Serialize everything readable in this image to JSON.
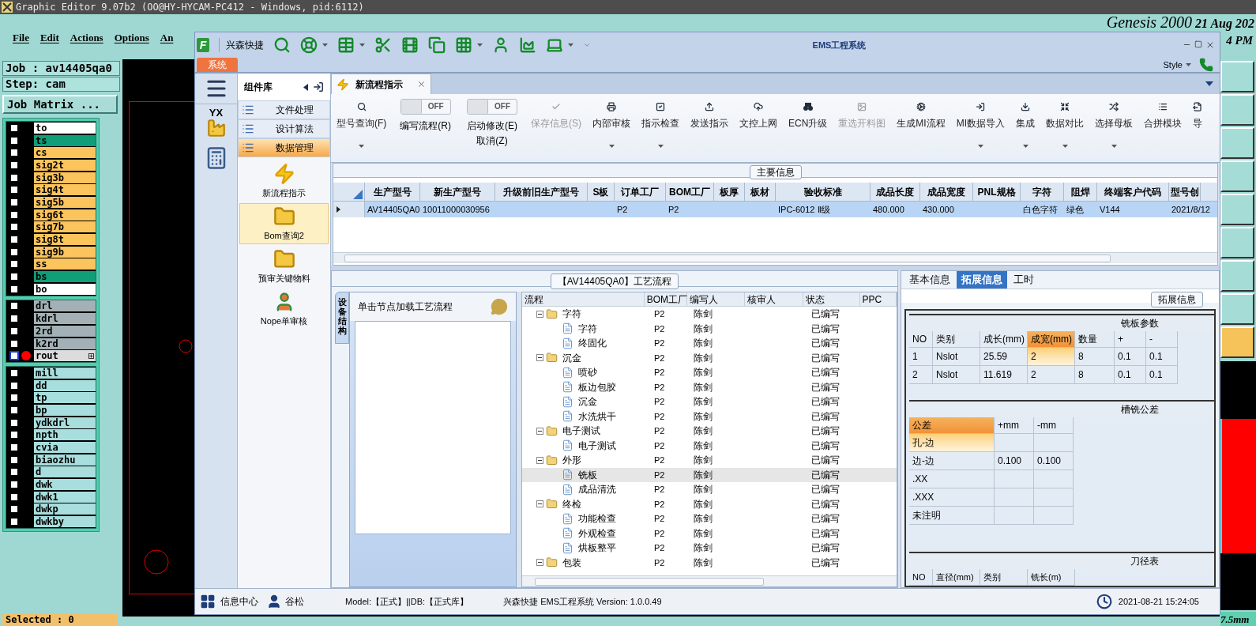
{
  "editor": {
    "title": "Graphic Editor 9.07b2 (OO@HY-HYCAM-PC412 - Windows, pid:6112)",
    "menu": [
      "File",
      "Edit",
      "Actions",
      "Options",
      "An"
    ],
    "brand": "Genesis 2000",
    "date": "21 Aug 202",
    "time": "4 PM",
    "job": "Job : av14405qa0",
    "step": "Step: cam",
    "job_matrix": "Job Matrix ...",
    "layer_groups": [
      {
        "layers": [
          {
            "name": "to",
            "color": "#ffffff",
            "checked": false,
            "selected": false
          },
          {
            "name": "ts",
            "color": "#0f9e78",
            "checked": false,
            "selected": false
          },
          {
            "name": "cs",
            "color": "#fcc45c",
            "checked": false,
            "selected": false
          },
          {
            "name": "sig2t",
            "color": "#fcc45c",
            "checked": false,
            "selected": false
          },
          {
            "name": "sig3b",
            "color": "#fcc45c",
            "checked": false,
            "selected": false
          },
          {
            "name": "sig4t",
            "color": "#fcc45c",
            "checked": false,
            "selected": false
          },
          {
            "name": "sig5b",
            "color": "#fcc45c",
            "checked": false,
            "selected": false
          },
          {
            "name": "sig6t",
            "color": "#fcc45c",
            "checked": false,
            "selected": false
          },
          {
            "name": "sig7b",
            "color": "#fcc45c",
            "checked": false,
            "selected": false
          },
          {
            "name": "sig8t",
            "color": "#fcc45c",
            "checked": false,
            "selected": false
          },
          {
            "name": "sig9b",
            "color": "#fcc45c",
            "checked": false,
            "selected": false
          },
          {
            "name": "ss",
            "color": "#fcc45c",
            "checked": false,
            "selected": false
          },
          {
            "name": "bs",
            "color": "#0f9e78",
            "checked": false,
            "selected": false
          },
          {
            "name": "bo",
            "color": "#ffffff",
            "checked": false,
            "selected": false
          }
        ]
      },
      {
        "layers": [
          {
            "name": "drl",
            "color": "#a3b1b6",
            "checked": false,
            "selected": false
          },
          {
            "name": "kdrl",
            "color": "#a3b1b6",
            "checked": false,
            "selected": false
          },
          {
            "name": "2rd",
            "color": "#a3b1b6",
            "checked": false,
            "selected": false
          },
          {
            "name": "k2rd",
            "color": "#a3b1b6",
            "checked": false,
            "selected": false
          },
          {
            "name": "rout",
            "color": "#dcdcdc",
            "checked": false,
            "selected": true
          }
        ]
      },
      {
        "layers": [
          {
            "name": "mill",
            "color": "#a8dedd",
            "checked": false,
            "selected": false
          },
          {
            "name": "dd",
            "color": "#a8dedd",
            "checked": false,
            "selected": false
          },
          {
            "name": "tp",
            "color": "#a8dedd",
            "checked": false,
            "selected": false
          },
          {
            "name": "bp",
            "color": "#a8dedd",
            "checked": false,
            "selected": false
          },
          {
            "name": "ydkdrl",
            "color": "#a8dedd",
            "checked": false,
            "selected": false
          },
          {
            "name": "npth",
            "color": "#a8dedd",
            "checked": false,
            "selected": false
          },
          {
            "name": "cvia",
            "color": "#a8dedd",
            "checked": false,
            "selected": false
          },
          {
            "name": "biaozhu",
            "color": "#a8dedd",
            "checked": false,
            "selected": false
          },
          {
            "name": "d",
            "color": "#a8dedd",
            "checked": false,
            "selected": false
          },
          {
            "name": "dwk",
            "color": "#a8dedd",
            "checked": false,
            "selected": false
          },
          {
            "name": "dwk1",
            "color": "#a8dedd",
            "checked": false,
            "selected": false
          },
          {
            "name": "dwkp",
            "color": "#a8dedd",
            "checked": false,
            "selected": false
          },
          {
            "name": "dwkby",
            "color": "#a8dedd",
            "checked": false,
            "selected": false
          }
        ]
      }
    ],
    "selected_count": "Selected : 0",
    "scale": "7.5mm"
  },
  "ems": {
    "logo_text": "F",
    "quick_label": "兴森快捷",
    "title": "EMS工程系统",
    "menu_tab": "系统",
    "style_label": "Style",
    "nav_logo_text": "YX",
    "library": {
      "title": "组件库",
      "groups": [
        {
          "label": "文件处理",
          "selected": false
        },
        {
          "label": "设计算法",
          "selected": false
        },
        {
          "label": "数据管理",
          "selected": true
        }
      ],
      "items": [
        {
          "label": "新流程指示",
          "kind": "lightning",
          "selected": false
        },
        {
          "label": "Bom查询2",
          "kind": "folder",
          "selected": true
        },
        {
          "label": "预审关键物料",
          "kind": "folder",
          "selected": false
        },
        {
          "label": "Nope单审核",
          "kind": "person",
          "selected": false
        }
      ]
    },
    "doc_tab": {
      "label": "新流程指示"
    },
    "toolbar": [
      {
        "kind": "button",
        "label": "型号查询(F)",
        "dropdown": true,
        "disabled": false
      },
      {
        "kind": "toggle",
        "label": "编写流程(R)",
        "state_text": "OFF",
        "on": false
      },
      {
        "kind": "toggle",
        "label": "启动修改(E)",
        "sublabel": "取消(Z)",
        "state_text": "OFF",
        "on": false
      },
      {
        "kind": "button",
        "label": "保存信息(S)",
        "dropdown": false,
        "disabled": true
      },
      {
        "kind": "button",
        "label": "内部审核",
        "dropdown": true,
        "disabled": false
      },
      {
        "kind": "button",
        "label": "指示检查",
        "dropdown": true,
        "disabled": false
      },
      {
        "kind": "button",
        "label": "发送指示",
        "dropdown": false,
        "disabled": false
      },
      {
        "kind": "button",
        "label": "文控上网",
        "dropdown": false,
        "disabled": false
      },
      {
        "kind": "button",
        "label": "ECN升级",
        "dropdown": false,
        "disabled": false
      },
      {
        "kind": "button",
        "label": "重选开料图",
        "dropdown": false,
        "disabled": true
      },
      {
        "kind": "button",
        "label": "生成MI流程",
        "dropdown": false,
        "disabled": false
      },
      {
        "kind": "button",
        "label": "MI数据导入",
        "dropdown": true,
        "disabled": false
      },
      {
        "kind": "button",
        "label": "集成",
        "dropdown": true,
        "disabled": false
      },
      {
        "kind": "button",
        "label": "数据对比",
        "dropdown": true,
        "disabled": false
      },
      {
        "kind": "button",
        "label": "选择母板",
        "dropdown": true,
        "disabled": false
      },
      {
        "kind": "button",
        "label": "合拼模块",
        "dropdown": false,
        "disabled": false
      },
      {
        "kind": "button",
        "label": "导",
        "dropdown": false,
        "disabled": false
      }
    ],
    "main_info": {
      "title": "主要信息",
      "columns": [
        "生产型号",
        "新生产型号",
        "升级前旧生产型号",
        "S板",
        "订单工厂",
        "BOM工厂",
        "板厚",
        "板材",
        "验收标准",
        "成品长度",
        "成品宽度",
        "PNL规格",
        "字符",
        "阻焊",
        "终端客户代码",
        "型号创"
      ],
      "rows": [
        {
          "selected": true,
          "cells": [
            "AV14405QA0",
            "10011000030956",
            null,
            null,
            "P2",
            "P2",
            null,
            null,
            "IPC-6012 Ⅱ级",
            "480.000",
            "430.000",
            null,
            "白色字符",
            "绿色",
            "V144",
            "2021/8/12"
          ]
        }
      ]
    },
    "process": {
      "title": "【AV14405QA0】工艺流程",
      "side_tab": "设备结构",
      "hint": "单击节点加载工艺流程",
      "columns": [
        "流程",
        "BOM工厂",
        "编写人",
        "核审人",
        "状态",
        "PPC"
      ],
      "tree": [
        {
          "name": "字符",
          "bom": "P2",
          "author": "陈剑",
          "status": "已编写",
          "expanded": true,
          "selected": false,
          "children": [
            {
              "name": "字符",
              "bom": "P2",
              "author": "陈剑",
              "status": "已编写",
              "selected": false
            },
            {
              "name": "终固化",
              "bom": "P2",
              "author": "陈剑",
              "status": "已编写",
              "selected": false
            }
          ]
        },
        {
          "name": "沉金",
          "bom": "P2",
          "author": "陈剑",
          "status": "已编写",
          "expanded": true,
          "selected": false,
          "children": [
            {
              "name": "喷砂",
              "bom": "P2",
              "author": "陈剑",
              "status": "已编写",
              "selected": false
            },
            {
              "name": "板边包胶",
              "bom": "P2",
              "author": "陈剑",
              "status": "已编写",
              "selected": false
            },
            {
              "name": "沉金",
              "bom": "P2",
              "author": "陈剑",
              "status": "已编写",
              "selected": false
            },
            {
              "name": "水洗烘干",
              "bom": "P2",
              "author": "陈剑",
              "status": "已编写",
              "selected": false
            }
          ]
        },
        {
          "name": "电子测试",
          "bom": "P2",
          "author": "陈剑",
          "status": "已编写",
          "expanded": true,
          "selected": false,
          "children": [
            {
              "name": "电子测试",
              "bom": "P2",
              "author": "陈剑",
              "status": "已编写",
              "selected": false
            }
          ]
        },
        {
          "name": "外形",
          "bom": "P2",
          "author": "陈剑",
          "status": "已编写",
          "expanded": true,
          "selected": false,
          "children": [
            {
              "name": "铣板",
              "bom": "P2",
              "author": "陈剑",
              "status": "已编写",
              "selected": true
            },
            {
              "name": "成品清洗",
              "bom": "P2",
              "author": "陈剑",
              "status": "已编写",
              "selected": false
            }
          ]
        },
        {
          "name": "终检",
          "bom": "P2",
          "author": "陈剑",
          "status": "已编写",
          "expanded": true,
          "selected": false,
          "children": [
            {
              "name": "功能检查",
              "bom": "P2",
              "author": "陈剑",
              "status": "已编写",
              "selected": false
            },
            {
              "name": "外观检查",
              "bom": "P2",
              "author": "陈剑",
              "status": "已编写",
              "selected": false
            },
            {
              "name": "烘板整平",
              "bom": "P2",
              "author": "陈剑",
              "status": "已编写",
              "selected": false
            }
          ]
        },
        {
          "name": "包装",
          "bom": "P2",
          "author": "陈剑",
          "status": "已编写",
          "expanded": true,
          "selected": false
        }
      ]
    },
    "details": {
      "tabs": [
        {
          "label": "基本信息",
          "selected": false
        },
        {
          "label": "拓展信息",
          "selected": true
        },
        {
          "label": "工时",
          "selected": false
        }
      ],
      "group_title": "拓展信息",
      "mill_params": {
        "title": "铣板参数",
        "columns": [
          {
            "label": "NO",
            "selected": false
          },
          {
            "label": "类别",
            "selected": false
          },
          {
            "label": "成长(mm)",
            "selected": false
          },
          {
            "label": "成宽(mm)",
            "selected": true
          },
          {
            "label": "数量",
            "selected": false
          },
          {
            "label": "+",
            "selected": false
          },
          {
            "label": "-",
            "selected": false
          }
        ],
        "rows": [
          {
            "selected": true,
            "cells": [
              "1",
              "Nslot",
              "25.59",
              "2",
              "8",
              "0.1",
              "0.1"
            ]
          },
          {
            "selected": false,
            "cells": [
              "2",
              "Nslot",
              "11.619",
              "2",
              "8",
              "0.1",
              "0.1"
            ]
          }
        ]
      },
      "tolerance": {
        "title": "槽铣公差",
        "columns": [
          {
            "label": "公差",
            "selected": true
          },
          {
            "label": "+mm",
            "selected": false
          },
          {
            "label": "-mm",
            "selected": false
          }
        ],
        "rows": [
          {
            "selected": true,
            "cells": [
              "孔-边",
              null,
              null
            ]
          },
          {
            "selected": false,
            "cells": [
              "边-边",
              "0.100",
              "0.100"
            ]
          },
          {
            "selected": false,
            "cells": [
              ".XX",
              null,
              null
            ]
          },
          {
            "selected": false,
            "cells": [
              ".XXX",
              null,
              null
            ]
          },
          {
            "selected": false,
            "cells": [
              "未注明",
              null,
              null
            ]
          }
        ]
      },
      "tools": {
        "title": "刀径表",
        "columns": [
          "NO",
          "直径(mm)",
          "类别",
          "铣长(m)"
        ]
      }
    },
    "status": {
      "info_center": "信息中心",
      "user": "谷松",
      "model": "Model:【正式】||DB:【正式库】",
      "product": "兴森快捷 EMS工程系统 Version: 1.0.0.49",
      "datetime": "2021-08-21 15:24:05"
    }
  }
}
